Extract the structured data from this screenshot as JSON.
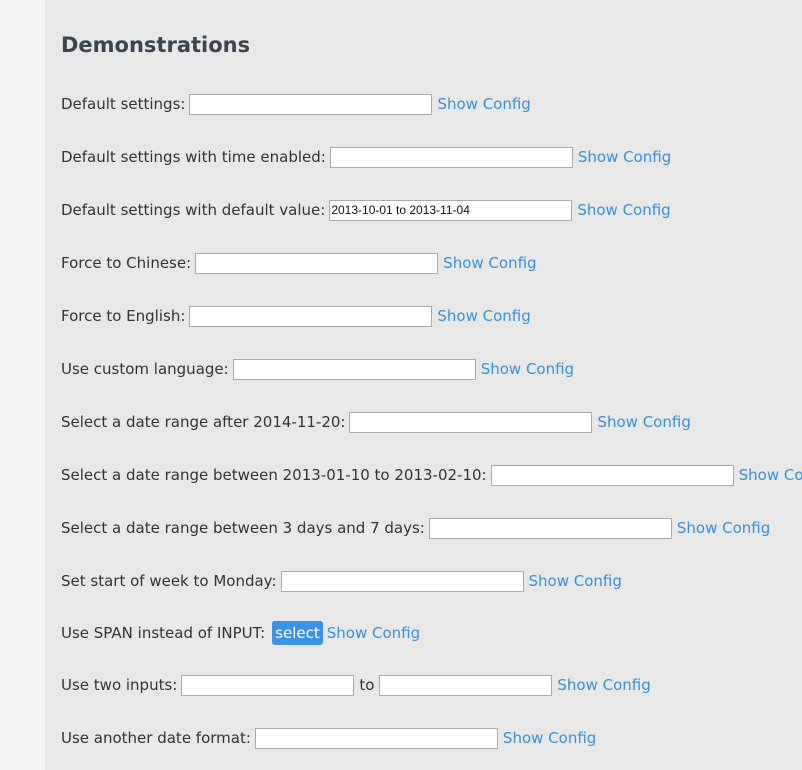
{
  "page_title": "Demonstrations",
  "show_config_label": "Show Config",
  "demos": [
    {
      "label": "Default settings:",
      "value": ""
    },
    {
      "label": "Default settings with time enabled:",
      "value": ""
    },
    {
      "label": "Default settings with default value:",
      "value": "2013-10-01 to 2013-11-04"
    },
    {
      "label": "Force to Chinese:",
      "value": ""
    },
    {
      "label": "Force to English:",
      "value": ""
    },
    {
      "label": "Use custom language:",
      "value": ""
    },
    {
      "label": "Select a date range after 2014-11-20:",
      "value": ""
    },
    {
      "label": "Select a date range between 2013-01-10 to 2013-02-10:",
      "value": ""
    },
    {
      "label": "Select a date range between 3 days and 7 days:",
      "value": ""
    },
    {
      "label": "Set start of week to Monday:",
      "value": ""
    },
    {
      "label": "Use SPAN instead of INPUT:",
      "span_text": "select"
    },
    {
      "label": "Use two inputs:",
      "value_start": "",
      "separator": "to",
      "value_end": ""
    },
    {
      "label": "Use another date format:",
      "value": ""
    }
  ],
  "colors": {
    "link": "#3b8fd9",
    "select_span_bg": "#3a93e4",
    "page_bg": "#e8e8e8",
    "title": "#3a4550"
  }
}
